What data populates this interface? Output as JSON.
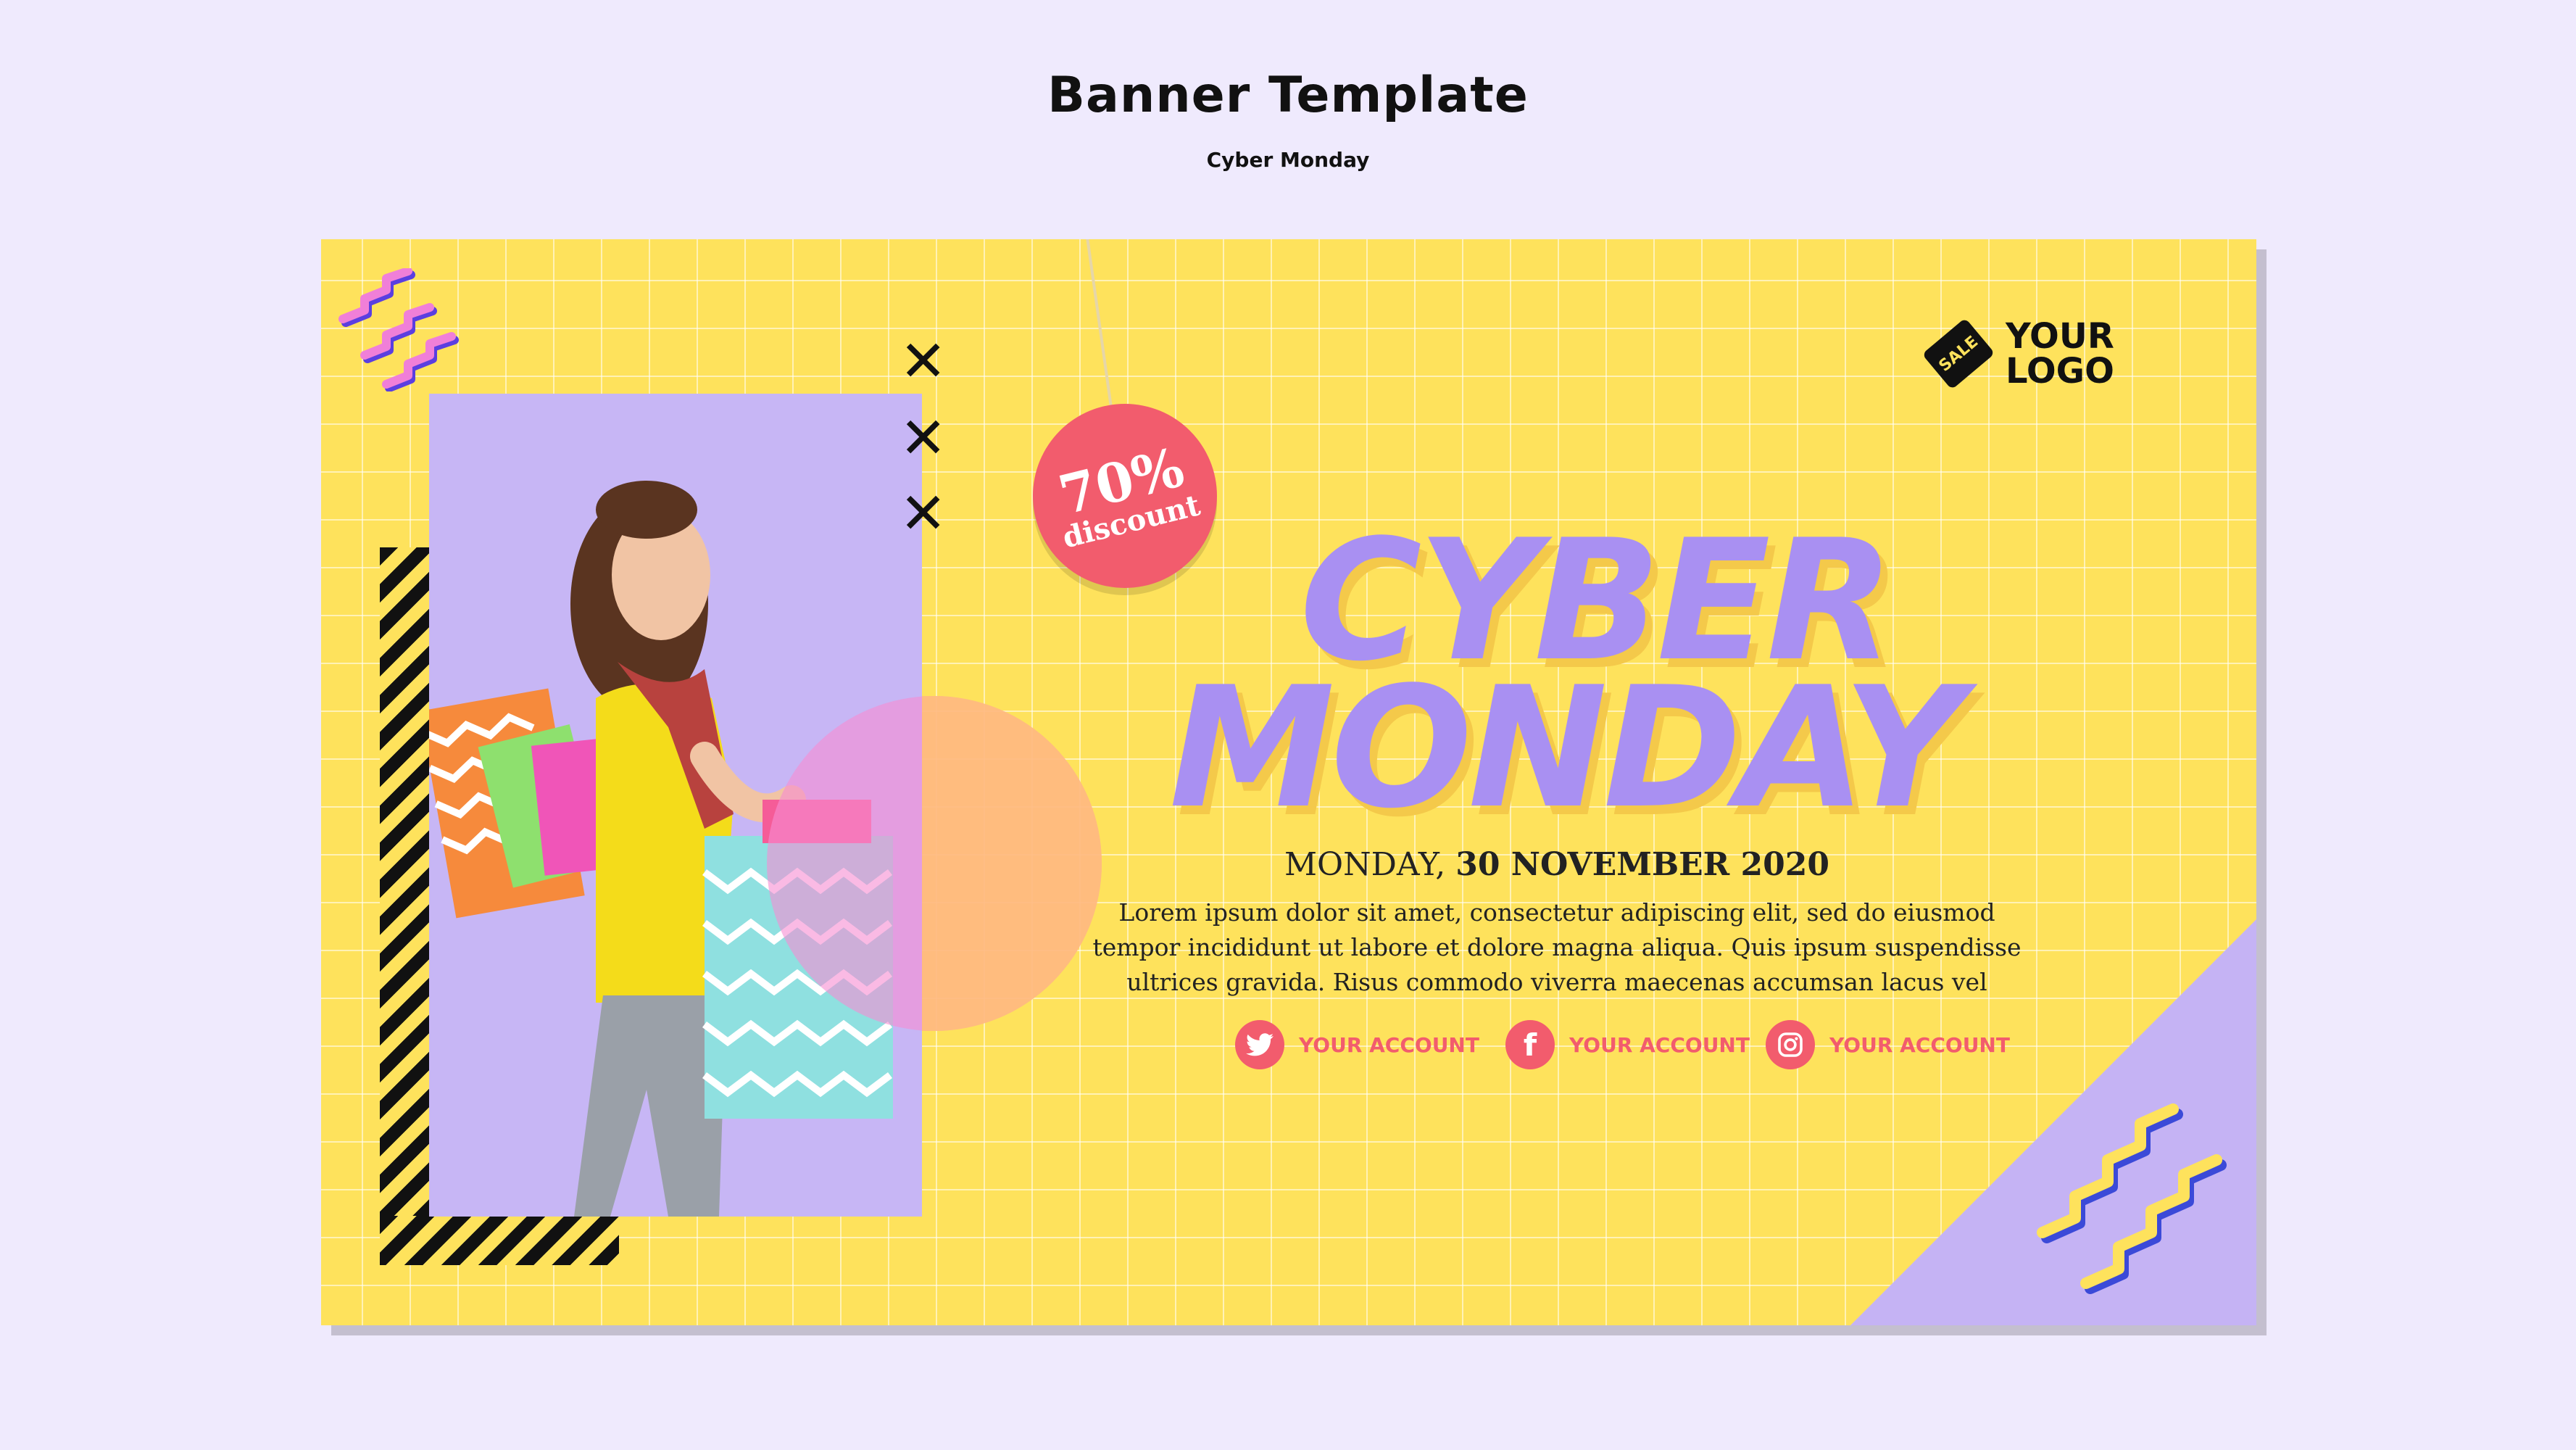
{
  "header": {
    "title": "Banner Template",
    "subtitle": "Cyber Monday"
  },
  "banner": {
    "colors": {
      "background": "#fee25c",
      "accent_purple": "#a990f2",
      "accent_red": "#f25c6d",
      "panel": "#c7b6f5"
    },
    "discount_tag": {
      "percent": "70%",
      "label": "discount"
    },
    "logo": {
      "tag_text": "SALE",
      "line1": "YOUR",
      "line2": "LOGO"
    },
    "headline": {
      "line1": "CYBER",
      "line2": "MONDAY"
    },
    "date": {
      "day": "MONDAY,",
      "date": "30 NOVEMBER 2020"
    },
    "body_lines": [
      "Lorem ipsum dolor sit amet, consectetur adipiscing elit, sed do eiusmod",
      "tempor incididunt ut labore et dolore magna aliqua. Quis ipsum suspendisse",
      "ultrices gravida. Risus commodo viverra maecenas accumsan lacus vel"
    ],
    "social": [
      {
        "icon": "twitter-icon",
        "label": "YOUR ACCOUNT"
      },
      {
        "icon": "facebook-icon",
        "label": "YOUR ACCOUNT"
      },
      {
        "icon": "instagram-icon",
        "label": "YOUR ACCOUNT"
      }
    ]
  }
}
